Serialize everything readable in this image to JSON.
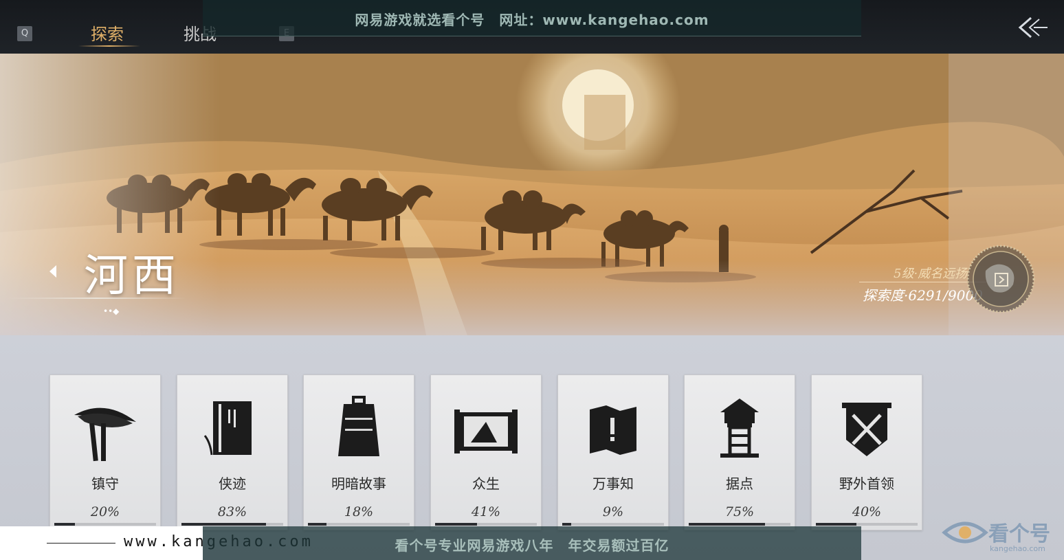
{
  "topbar": {
    "key_left": "Q",
    "key_right": "E",
    "tabs": [
      {
        "label": "探索",
        "active": true
      },
      {
        "label": "挑战",
        "active": false
      }
    ]
  },
  "watermark": {
    "top_text": "网易游戏就选看个号　网址：www.kangehao.com",
    "bottom_text": "看个号专业网易游戏八年　年交易额过百亿",
    "url_text": "www.kangehao.com",
    "logo_text": "看个号",
    "logo_sub": "kangehao.com"
  },
  "region": {
    "name": "河西",
    "dots": "••◆",
    "level": "5级·威名远扬",
    "explore": "探索度·6291/9000"
  },
  "cards": [
    {
      "label": "镇守",
      "pct_text": "20%",
      "progress": 0.2,
      "icon": "hat-sword-icon"
    },
    {
      "label": "侠迹",
      "pct_text": "83%",
      "progress": 0.83,
      "icon": "scroll-book-icon"
    },
    {
      "label": "明暗故事",
      "pct_text": "18%",
      "progress": 0.18,
      "icon": "bell-icon"
    },
    {
      "label": "众生",
      "pct_text": "41%",
      "progress": 0.41,
      "icon": "painting-scroll-icon"
    },
    {
      "label": "万事知",
      "pct_text": "9%",
      "progress": 0.09,
      "icon": "map-book-icon"
    },
    {
      "label": "据点",
      "pct_text": "75%",
      "progress": 0.75,
      "icon": "watchtower-icon"
    },
    {
      "label": "野外首领",
      "pct_text": "40%",
      "progress": 0.4,
      "icon": "crossed-swords-banner-icon"
    }
  ],
  "colors": {
    "accent": "#e0b068",
    "bar_fill": "#2a2c30"
  }
}
